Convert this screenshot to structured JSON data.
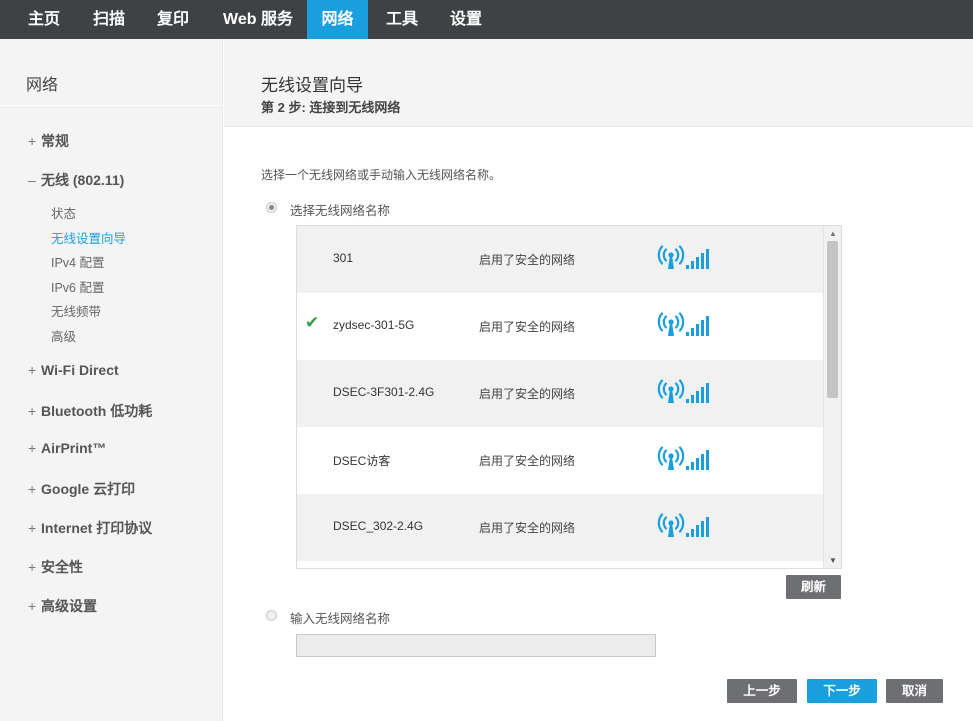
{
  "nav": {
    "tabs": [
      {
        "label": "主页"
      },
      {
        "label": "扫描"
      },
      {
        "label": "复印"
      },
      {
        "label": "Web 服务"
      },
      {
        "label": "网络"
      },
      {
        "label": "工具"
      },
      {
        "label": "设置"
      }
    ],
    "active_tab": "网络"
  },
  "sidebar": {
    "title": "网络",
    "groups": [
      {
        "sign": "+",
        "label": "常规"
      },
      {
        "sign": "–",
        "label": "无线 (802.11)",
        "expanded": true
      },
      {
        "sign": "+",
        "label": "Wi-Fi Direct"
      },
      {
        "sign": "+",
        "label": "Bluetooth 低功耗"
      },
      {
        "sign": "+",
        "label": "AirPrint™"
      },
      {
        "sign": "+",
        "label": "Google 云打印"
      },
      {
        "sign": "+",
        "label": "Internet 打印协议"
      },
      {
        "sign": "+",
        "label": "安全性"
      },
      {
        "sign": "+",
        "label": "高级设置"
      }
    ],
    "wireless_items": [
      {
        "label": "状态"
      },
      {
        "label": "无线设置向导",
        "active": true
      },
      {
        "label": "IPv4 配置"
      },
      {
        "label": "IPv6 配置"
      },
      {
        "label": "无线频带"
      },
      {
        "label": "高级"
      }
    ]
  },
  "main": {
    "title": "无线设置向导",
    "step": "第 2 步: 连接到无线网络",
    "instruction": "选择一个无线网络或手动输入无线网络名称。",
    "option_select": {
      "label": "选择无线网络名称",
      "checked": true
    },
    "option_manual": {
      "label": "输入无线网络名称",
      "checked": false
    },
    "manual_input": {
      "value": "",
      "placeholder": ""
    },
    "networks": [
      {
        "name": "301",
        "security": "启用了安全的网络",
        "selected": false
      },
      {
        "name": "zydsec-301-5G",
        "security": "启用了安全的网络",
        "selected": true
      },
      {
        "name": "DSEC-3F301-2.4G",
        "security": "启用了安全的网络",
        "selected": false
      },
      {
        "name": "DSEC访客",
        "security": "启用了安全的网络",
        "selected": false
      },
      {
        "name": "DSEC_302-2.4G",
        "security": "启用了安全的网络",
        "selected": false
      }
    ],
    "signal_icon": "wifi-signal-icon",
    "check_icon": "check-icon",
    "refresh_button": "刷新",
    "buttons": {
      "back": "上一步",
      "next": "下一步",
      "cancel": "取消"
    }
  },
  "colors": {
    "nav_bg": "#3f4245",
    "accent": "#1a9fde",
    "button_gray": "#6d6f72",
    "check_green": "#2f9e44",
    "signal_blue": "#1a9fde"
  }
}
